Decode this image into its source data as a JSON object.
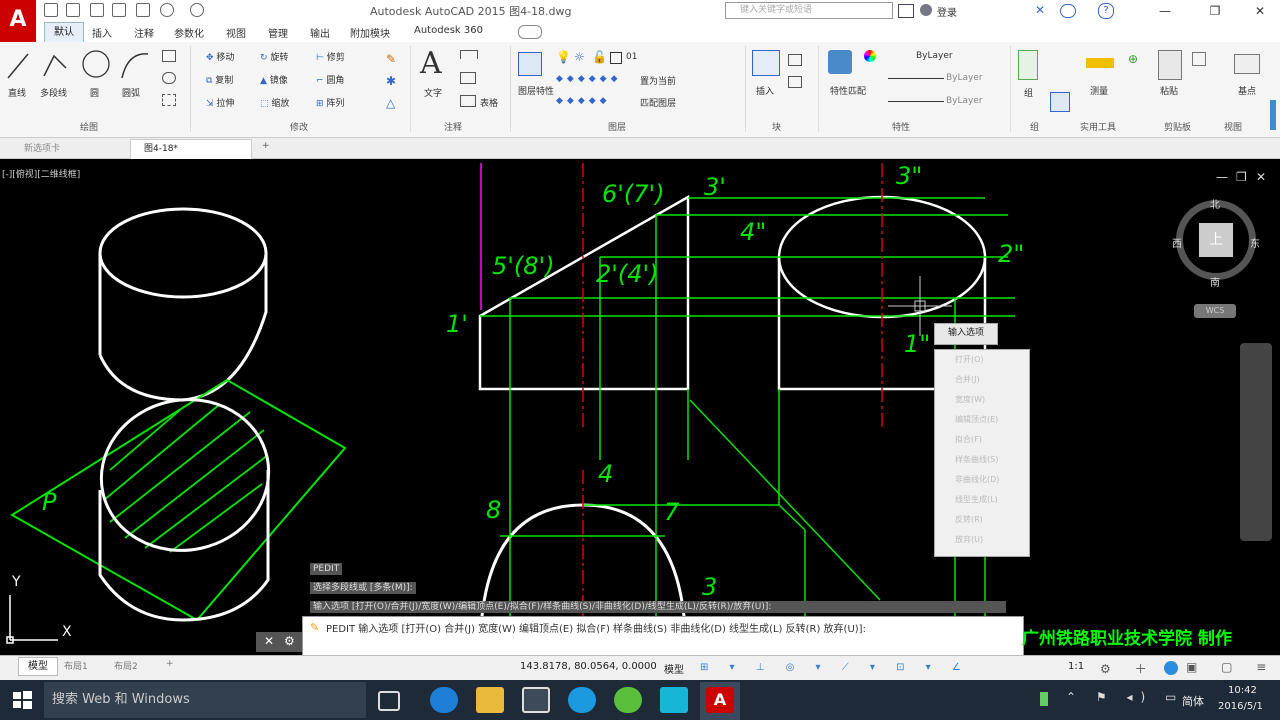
{
  "window": {
    "title": "Autodesk AutoCAD 2015    图4-18.dwg",
    "search_placeholder": "键入关键字或短语",
    "user": "登录",
    "minimize": "—",
    "maximize": "❐",
    "close": "✕"
  },
  "ribbon_tabs": [
    "默认",
    "插入",
    "注释",
    "参数化",
    "视图",
    "管理",
    "输出",
    "附加模块",
    "Autodesk 360"
  ],
  "active_tab": "默认",
  "ribbon": {
    "draw_tools": [
      "直线",
      "多段线",
      "圆",
      "圆弧"
    ],
    "modify_tools": [
      "移动",
      "旋转",
      "修剪",
      "复制",
      "镜像",
      "圆角",
      "拉伸",
      "缩放",
      "阵列"
    ],
    "text_tool": "文字",
    "table_tool": "表格",
    "layer_tools": [
      "图层特性",
      "置为当前",
      "匹配图层"
    ],
    "insert_tool": "插入",
    "match_tool": "特性匹配",
    "bylayer_1": "ByLayer",
    "bylayer_2": "ByLayer",
    "bylayer_3": "ByLayer",
    "group_tool": "组",
    "measure_tool": "测量",
    "paste_tool": "粘贴",
    "base_tool": "基点",
    "panels": [
      "绘图",
      "修改",
      "注释",
      "图层",
      "块",
      "特性",
      "组",
      "实用工具",
      "剪贴板",
      "视图"
    ]
  },
  "doc_tabs": [
    "新选项卡",
    "图4-18*",
    "+"
  ],
  "viewport_label": "[-][俯视][二维线框]",
  "drawing_labels": {
    "l6_7": "6'(7')",
    "l3p": "3'",
    "l3pp": "3\"",
    "l4pp": "4\"",
    "l2pp": "2\"",
    "l5_8": "5'(8')",
    "l2_4": "2'(4')",
    "l1p": "1'",
    "l1pp": "1\"",
    "l4": "4",
    "l8": "8",
    "l7": "7",
    "l3": "3",
    "lP": "P"
  },
  "compass": {
    "north": "北",
    "south": "南",
    "east": "东",
    "west": "西",
    "top": "上",
    "wcs": "WCS"
  },
  "ucs": {
    "x": "X",
    "y": "Y"
  },
  "context_tip": "输入选项",
  "context_menu": [
    "打开(O)",
    "合并(J)",
    "宽度(W)",
    "编辑顶点(E)",
    "拟合(F)",
    "样条曲线(S)",
    "非曲线化(D)",
    "线型生成(L)",
    "反转(R)",
    "放弃(U)"
  ],
  "command_history": [
    "PEDIT",
    "选择多段线或 [多条(M)]:",
    "输入选项 [打开(O)/合并(J)/宽度(W)/编辑顶点(E)/拟合(F)/样条曲线(S)/非曲线化(D)/线型生成(L)/反转(R)/放弃(U)]:"
  ],
  "command_line": "PEDIT 输入选项 [打开(O) 合并(J) 宽度(W) 编辑顶点(E) 拟合(F) 样条曲线(S) 非曲线化(D) 线型生成(L) 反转(R) 放弃(U)]:",
  "credit": "广州铁路职业技术学院 制作",
  "status": {
    "layout_tabs": [
      "模型",
      "布局1",
      "布局2",
      "+"
    ],
    "coords": "143.8178, 80.0564, 0.0000",
    "model": "模型",
    "scale": "1:1"
  },
  "taskbar": {
    "search": "搜索 Web 和 Windows",
    "ime": "简体",
    "time": "10:42",
    "date": "2016/5/1"
  },
  "colors": {
    "green": "#00e600",
    "white": "#ffffff",
    "red": "#e00000",
    "magenta": "#cc00cc",
    "autocad_red": "#cc0000"
  }
}
